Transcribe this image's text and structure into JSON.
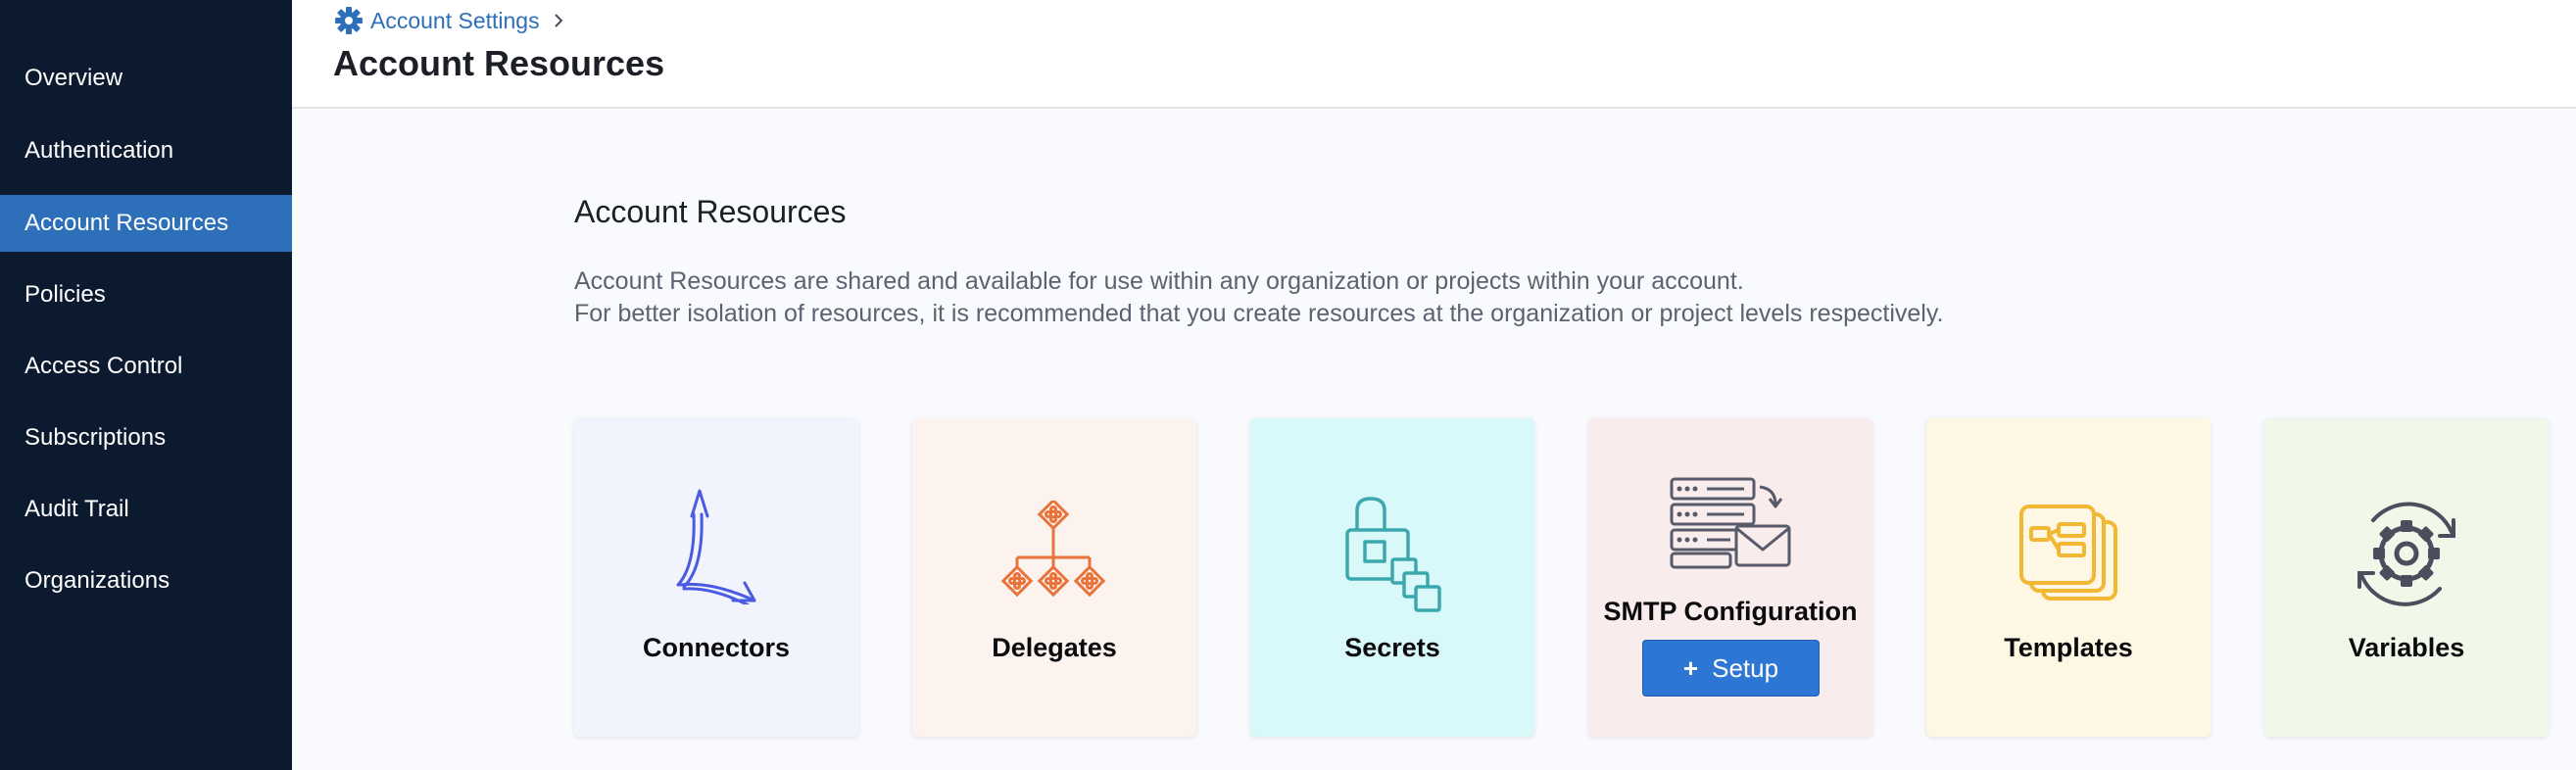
{
  "sidebar": {
    "items": [
      {
        "label": "Overview"
      },
      {
        "label": "Authentication"
      },
      {
        "label": "Account Resources",
        "active": true
      },
      {
        "label": "Policies"
      },
      {
        "label": "Access Control"
      },
      {
        "label": "Subscriptions"
      },
      {
        "label": "Audit Trail"
      },
      {
        "label": "Organizations"
      }
    ]
  },
  "header": {
    "breadcrumb": "Account Settings",
    "title": "Account Resources"
  },
  "main": {
    "title": "Account Resources",
    "description_line1": "Account Resources are shared and available for use within any organization or projects within your account.",
    "description_line2": "For better isolation of resources, it is recommended that you create resources at the organization or project levels respectively.",
    "cards": [
      {
        "label": "Connectors",
        "icon": "connectors-icon",
        "bg": "#f1f4fd"
      },
      {
        "label": "Delegates",
        "icon": "delegates-icon",
        "bg": "#fcf2ee"
      },
      {
        "label": "Secrets",
        "icon": "secrets-icon",
        "bg": "#d8f8f9"
      },
      {
        "label": "SMTP Configuration",
        "icon": "smtp-icon",
        "bg": "#f8ecec",
        "button": "Setup",
        "button_icon": "plus-icon"
      },
      {
        "label": "Templates",
        "icon": "templates-icon",
        "bg": "#fdf7e4"
      },
      {
        "label": "Variables",
        "icon": "variables-icon",
        "bg": "#f1f8ea"
      }
    ]
  },
  "colors": {
    "sidebar_bg": "#0b1a2e",
    "accent": "#2d6fb9",
    "button": "#2d76d4"
  }
}
